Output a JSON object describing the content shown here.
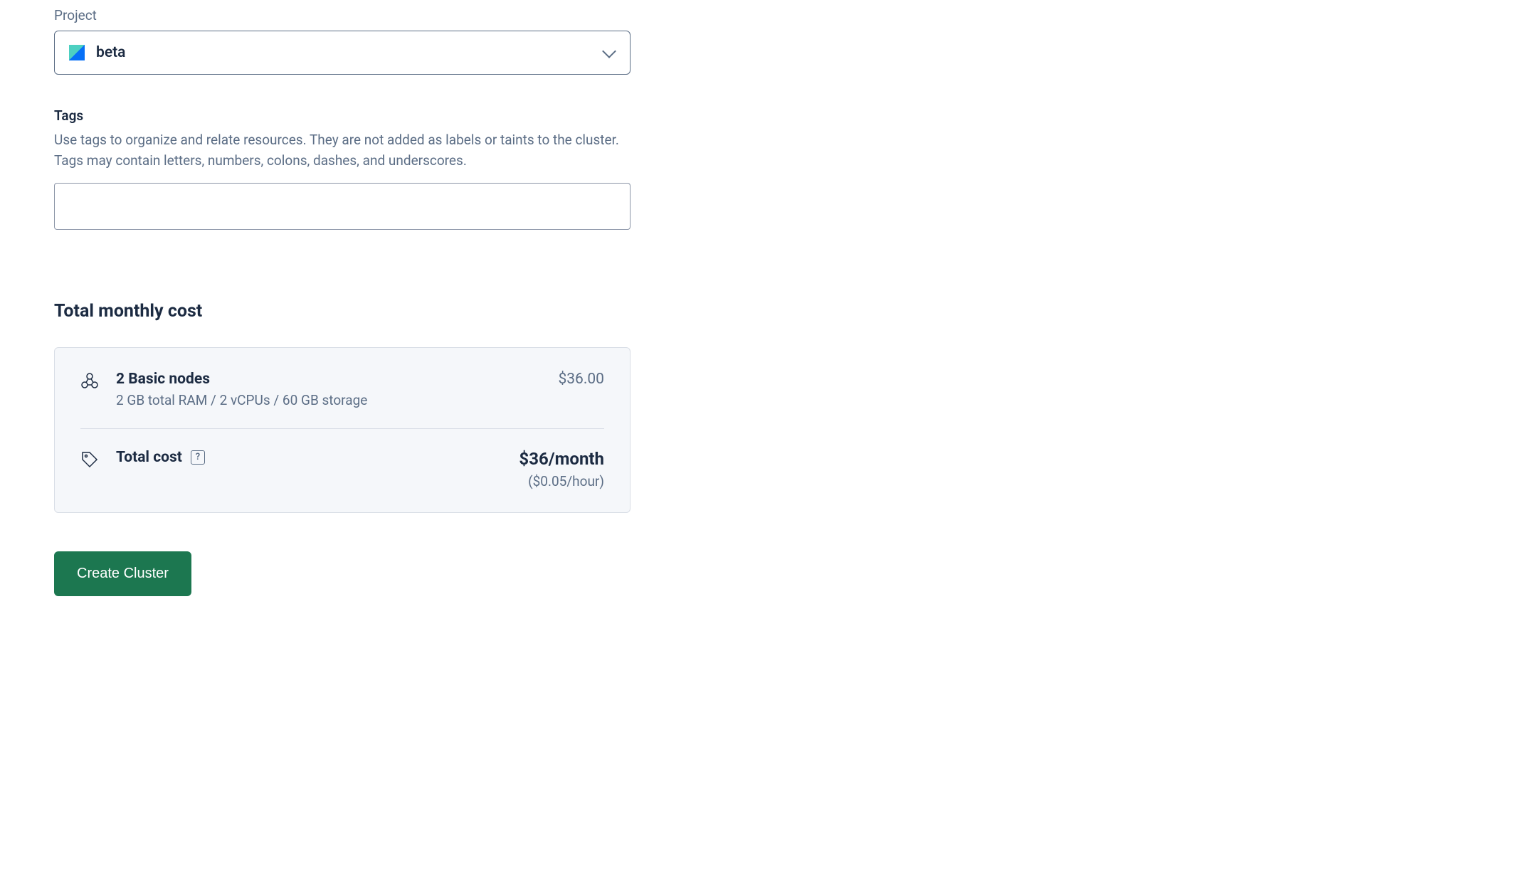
{
  "project": {
    "label": "Project",
    "selected": "beta"
  },
  "tags": {
    "label": "Tags",
    "helper": "Use tags to organize and relate resources. They are not added as labels or taints to the cluster. Tags may contain letters, numbers, colons, dashes, and underscores."
  },
  "cost": {
    "heading": "Total monthly cost",
    "line_item": {
      "title": "2 Basic nodes",
      "details": "2 GB total RAM / 2 vCPUs / 60 GB storage",
      "price": "$36.00"
    },
    "total": {
      "label": "Total cost",
      "help": "?",
      "monthly": "$36/month",
      "hourly": "($0.05/hour)"
    }
  },
  "actions": {
    "create_label": "Create Cluster"
  }
}
